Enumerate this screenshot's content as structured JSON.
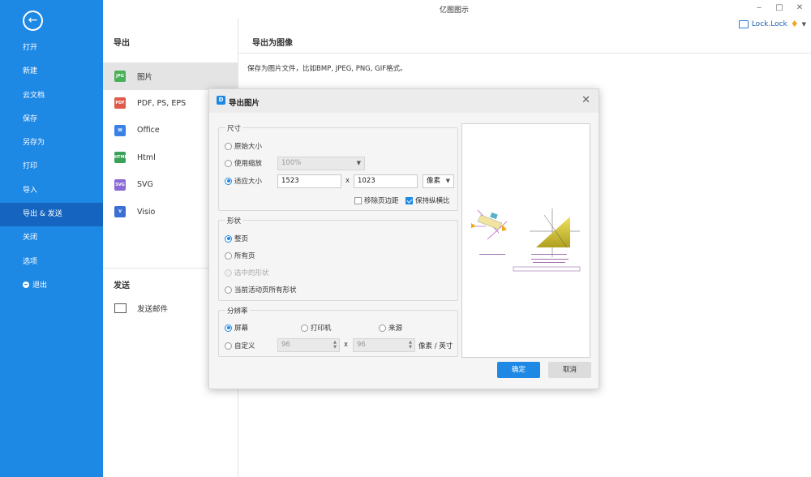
{
  "window": {
    "title": "亿图图示",
    "minimize": "‒",
    "maximize": "□",
    "close": "✕"
  },
  "user": {
    "name": "Lock.Lock",
    "badge_icon": "diamond-icon",
    "menu_icon": "caret-down-icon"
  },
  "sidebar": {
    "back_icon": "arrow-left-icon",
    "items": [
      {
        "label": "打开"
      },
      {
        "label": "新建"
      },
      {
        "label": "云文档"
      },
      {
        "label": "保存"
      },
      {
        "label": "另存为"
      },
      {
        "label": "打印"
      },
      {
        "label": "导入"
      },
      {
        "label": "导出 & 发送",
        "active": true
      },
      {
        "label": "关闭"
      },
      {
        "label": "选项"
      },
      {
        "label": "退出",
        "icon": "exit-icon"
      }
    ]
  },
  "export": {
    "heading": "导出",
    "formats": [
      {
        "label": "图片",
        "icon_text": "JPG",
        "color": "#4ab05a",
        "active": true
      },
      {
        "label": "PDF, PS, EPS",
        "icon_text": "PDF",
        "color": "#e05a4a"
      },
      {
        "label": "Office",
        "icon_text": "W",
        "color": "#3b82e6"
      },
      {
        "label": "Html",
        "icon_text": "HTML",
        "color": "#3aa05a"
      },
      {
        "label": "SVG",
        "icon_text": "SVG",
        "color": "#8a6ad6"
      },
      {
        "label": "Visio",
        "icon_text": "V",
        "color": "#3b6fd6"
      }
    ]
  },
  "send": {
    "heading": "发送",
    "mail_label": "发送邮件",
    "mail_icon": "mail-send-icon"
  },
  "content": {
    "title": "导出为图像",
    "description": "保存为图片文件，比如BMP, JPEG, PNG, GIF格式。"
  },
  "dialog": {
    "title": "导出图片",
    "logo_text": "D",
    "size_group": {
      "label": "尺寸",
      "original_size": "原始大小",
      "use_zoom": "使用缩放",
      "zoom_value": "100%",
      "fit_size": "适应大小",
      "width": "1523",
      "times": "x",
      "height": "1023",
      "unit": "像素",
      "remove_margin": "移除页边距",
      "keep_ratio": "保持纵横比"
    },
    "shape_group": {
      "label": "形状",
      "whole_page": "整页",
      "all_pages": "所有页",
      "selected_shapes": "选中的形状",
      "current_page_shapes": "当前活动页所有形状"
    },
    "resolution_group": {
      "label": "分辨率",
      "screen": "屏幕",
      "printer": "打印机",
      "source": "来源",
      "custom": "自定义",
      "dpi_x": "96",
      "times": "x",
      "dpi_y": "96",
      "unit": "像素 / 英寸"
    },
    "ok": "确定",
    "cancel": "取消"
  }
}
